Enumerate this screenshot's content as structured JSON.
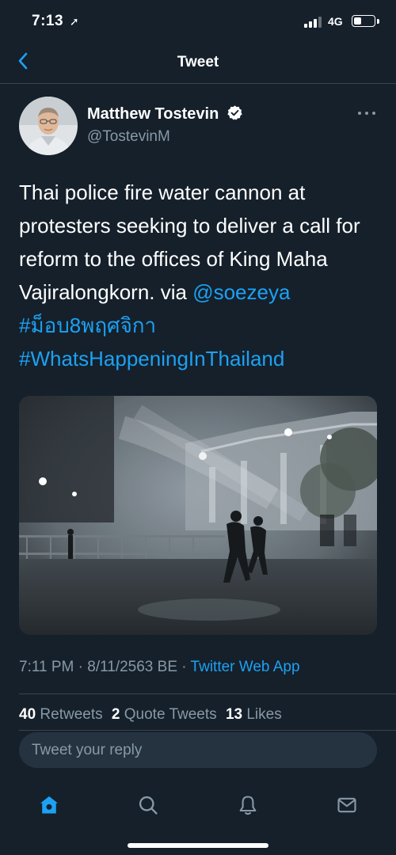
{
  "status_bar": {
    "time": "7:13",
    "network": "4G"
  },
  "header": {
    "title": "Tweet",
    "back_icon": "chevron-left-icon"
  },
  "author": {
    "name": "Matthew Tostevin",
    "handle": "@TostevinM",
    "verified": true
  },
  "tweet": {
    "text_line1": "Thai police fire water cannon at protesters seeking to deliver a call for reform to the offices of King Maha Vajiralongkorn. via ",
    "mention": "@soezeya",
    "hashtag1": "#ม็อบ8พฤศจิกา",
    "hashtag2": "#WhatsHappeningInThailand"
  },
  "meta": {
    "time": "7:11 PM",
    "date": "8/11/2563 BE",
    "source": "Twitter Web App",
    "separator": " · "
  },
  "stats": {
    "retweets_count": "40",
    "retweets_label": "Retweets",
    "quotes_count": "2",
    "quotes_label": "Quote Tweets",
    "likes_count": "13",
    "likes_label": "Likes"
  },
  "reply": {
    "placeholder": "Tweet your reply"
  },
  "tabbar": {
    "items": [
      "home-icon",
      "search-icon",
      "notifications-icon",
      "messages-icon"
    ],
    "active": "home-icon"
  },
  "colors": {
    "background": "#15202b",
    "accent": "#1da1f2",
    "secondary_text": "#8899a6",
    "divider": "#38444d"
  }
}
